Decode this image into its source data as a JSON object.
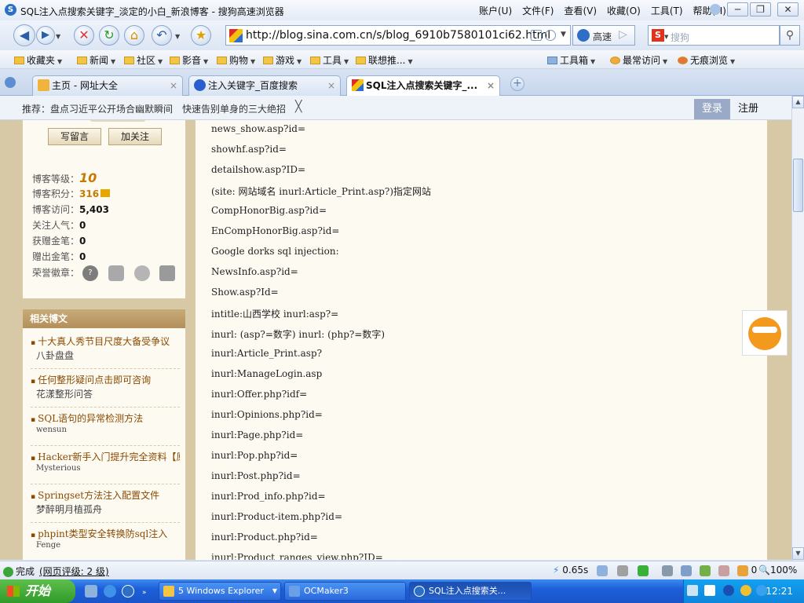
{
  "window": {
    "title": "SQL注入点搜索关键字_淡定的小白_新浪博客 - 搜狗高速浏览器",
    "menu": [
      "账户(U)",
      "文件(F)",
      "查看(V)",
      "收藏(O)",
      "工具(T)",
      "帮助(H)"
    ],
    "controls": {
      "minimize": "─",
      "restore": "❐",
      "close": "✕"
    }
  },
  "nav": {
    "url": "http://blog.sina.com.cn/s/blog_6910b7580101ci62.html",
    "speed_label": "高速",
    "search_placeholder": "搜狗"
  },
  "favorites": {
    "items": [
      "收藏夹",
      "新闻",
      "社区",
      "影音",
      "购物",
      "游戏",
      "工具",
      "联想推..."
    ],
    "right": [
      "工具箱",
      "最常访问",
      "无痕浏览"
    ]
  },
  "tabs": [
    {
      "label": "主页 - 网址大全"
    },
    {
      "label": "注入关键字_百度搜索"
    },
    {
      "label": "SQL注入点搜索关键字_..."
    }
  ],
  "notice": {
    "prefix": "推荐：",
    "item1": "盘点习近平公开场合幽默瞬间",
    "item2": "快速告别单身的三大绝招",
    "close": "╳",
    "login": "登录",
    "register": "注册"
  },
  "profile": {
    "btn_message": "写留言",
    "btn_follow": "加关注",
    "stats": [
      {
        "label": "博客等级：",
        "value": "10"
      },
      {
        "label": "博客积分：",
        "value": "316"
      },
      {
        "label": "博客访问：",
        "value": "5,403"
      },
      {
        "label": "关注人气：",
        "value": "0"
      },
      {
        "label": "获赠金笔：",
        "value": "0"
      },
      {
        "label": "赠出金笔：",
        "value": "0"
      },
      {
        "label": "荣誉徽章：",
        "value": ""
      }
    ]
  },
  "related": {
    "header": "相关博文",
    "items": [
      {
        "title": "十大真人秀节目尺度大备受争议",
        "author": "八卦盘盘"
      },
      {
        "title": "任何整形疑问点击即可咨询",
        "author": "花漾整形问答"
      },
      {
        "title": "SQL语句的异常检测方法",
        "author": "wensun"
      },
      {
        "title": "Hacker新手入门提升完全资料【原",
        "author": "Mysterious"
      },
      {
        "title": "Springset方法注入配置文件",
        "author": "梦醉明月植孤舟"
      },
      {
        "title": "phpint类型安全转换防sql注入",
        "author": "Fenge"
      }
    ]
  },
  "article": {
    "lines": [
      "news_show.asp?id=",
      "showhf.asp?id=",
      "detailshow.asp?ID=",
      "(site: 网站域名 inurl:Article_Print.asp?)指定网站",
      "CompHonorBig.asp?id=",
      "EnCompHonorBig.asp?id=",
      "Google dorks sql injection:",
      "NewsInfo.asp?id=",
      "Show.asp?Id=",
      "intitle:山西学校 inurl:asp?=",
      "inurl: (asp?=数字) inurl: (php?=数字)",
      "inurl:Article_Print.asp?",
      "inurl:ManageLogin.asp",
      "inurl:Offer.php?idf=",
      "inurl:Opinions.php?id=",
      "inurl:Page.php?id=",
      "inurl:Pop.php?id=",
      "inurl:Post.php?id=",
      "inurl:Prod_info.php?id=",
      "inurl:Product-item.php?id=",
      "inurl:Product.php?id=",
      "inurl:Product_ranges_view.php?ID="
    ]
  },
  "status": {
    "done": "完成",
    "rating": "(网页评级: 2 级)",
    "time": "0.65s",
    "count": "0",
    "zoom": "100%"
  },
  "taskbar": {
    "start": "开始",
    "items": [
      "5 Windows Explorer",
      "OCMaker3",
      "SQL注入点搜索关..."
    ],
    "clock": "12:21"
  },
  "colors": {
    "accent": "#2c6fc4",
    "page_bg": "#d8c9a6",
    "content_bg": "#fdfaf2",
    "link": "#8a4a00"
  }
}
